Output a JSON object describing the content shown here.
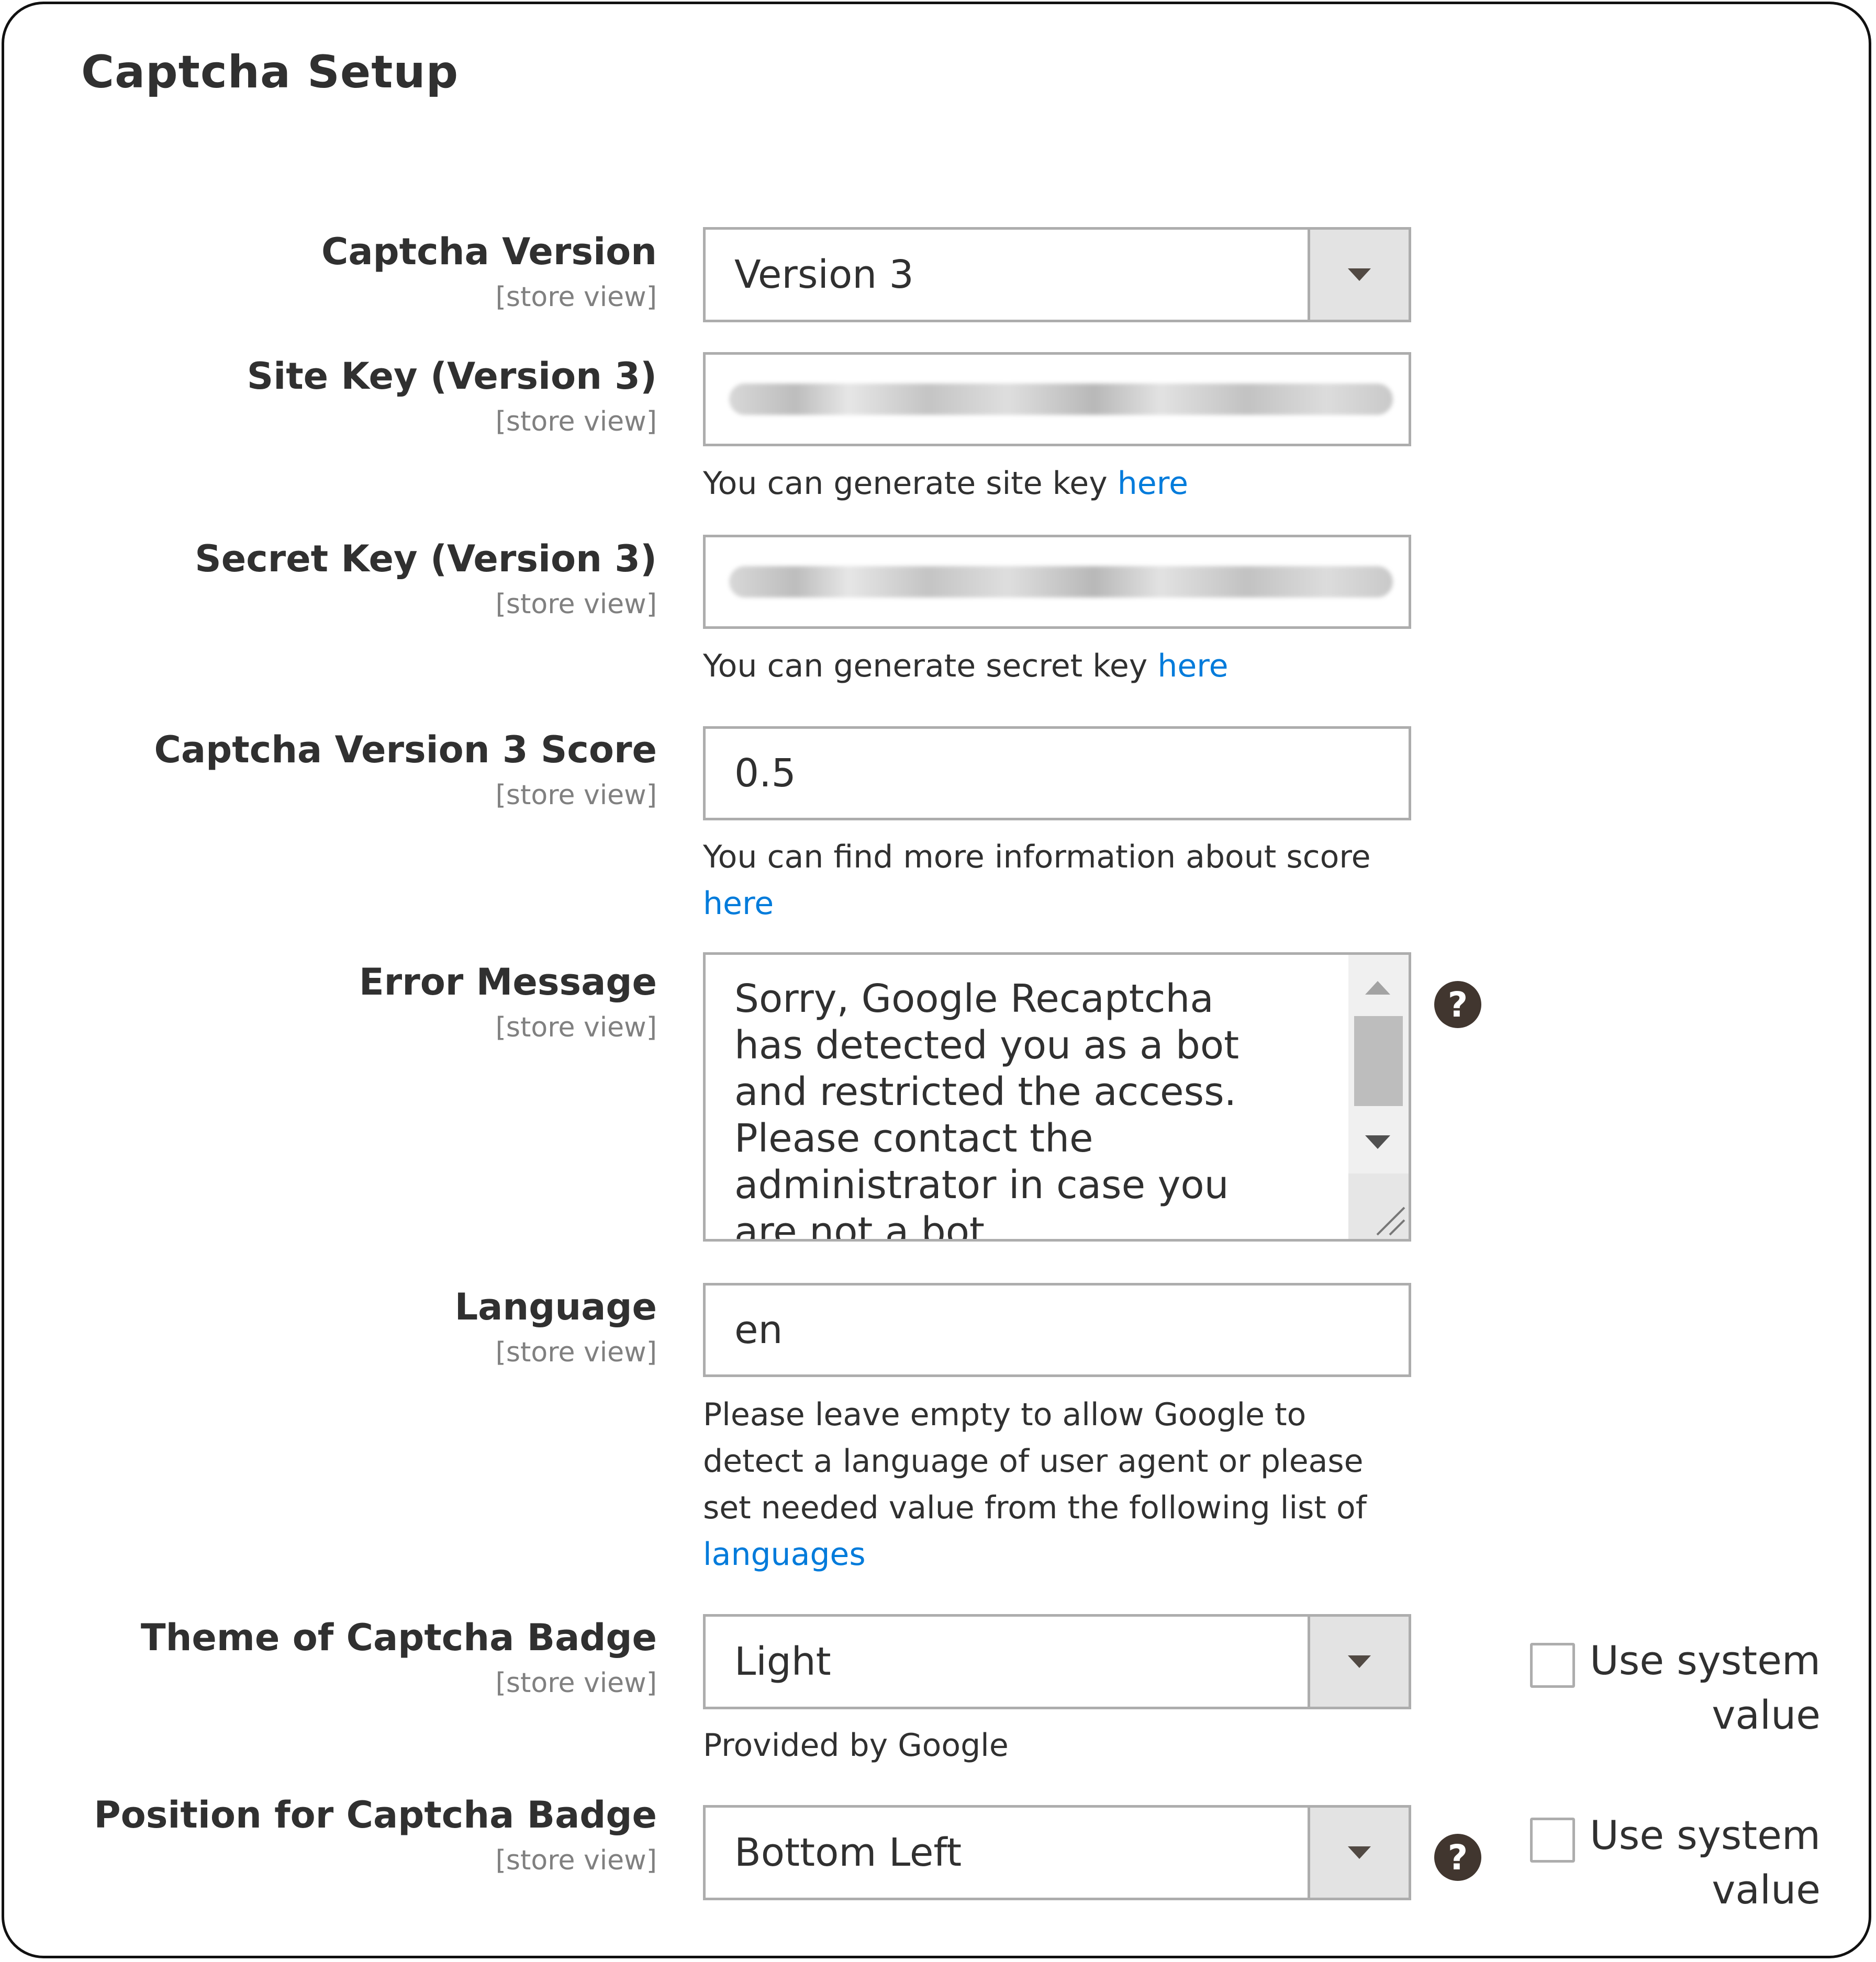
{
  "section": {
    "title": "Captcha Setup"
  },
  "scope_label": "[store view]",
  "fields": {
    "captcha_version": {
      "label": "Captcha Version",
      "scope": "[store view]",
      "value": "Version 3"
    },
    "site_key": {
      "label": "Site Key (Version 3)",
      "scope": "[store view]",
      "value_obscured": true,
      "note_text": "You can generate site key ",
      "note_link": "here"
    },
    "secret_key": {
      "label": "Secret Key (Version 3)",
      "scope": "[store view]",
      "value_obscured": true,
      "note_text": "You can generate secret key ",
      "note_link": "here"
    },
    "score": {
      "label": "Captcha Version 3 Score",
      "scope": "[store view]",
      "value": "0.5",
      "note_text": "You can find more information about score",
      "note_link": "here"
    },
    "error_message": {
      "label": "Error Message",
      "scope": "[store view]",
      "value": "Sorry, Google Recaptcha has detected you as a bot and restricted the access. Please contact the administrator in case you are not a bot.",
      "help_icon": "question-circle-icon"
    },
    "language": {
      "label": "Language",
      "scope": "[store view]",
      "value": "en",
      "note_text": "Please leave empty to allow Google to detect a language of user agent or please set needed value from the following list of",
      "note_link": "languages"
    },
    "theme": {
      "label": "Theme of Captcha Badge",
      "scope": "[store view]",
      "value": "Light",
      "note_text": "Provided by Google",
      "use_system_value_label": "Use system value",
      "use_system_value_checked": false
    },
    "position": {
      "label": "Position for Captcha Badge",
      "scope": "[store view]",
      "value": "Bottom Left",
      "help_icon": "question-circle-icon",
      "use_system_value_label": "Use system value",
      "use_system_value_checked": false
    }
  },
  "colors": {
    "text": "#303030",
    "scope": "#808080",
    "link": "#007bdb",
    "border": "#adadad",
    "select_arrow_bg": "#e3e3e3",
    "help_icon": "#41362f"
  }
}
